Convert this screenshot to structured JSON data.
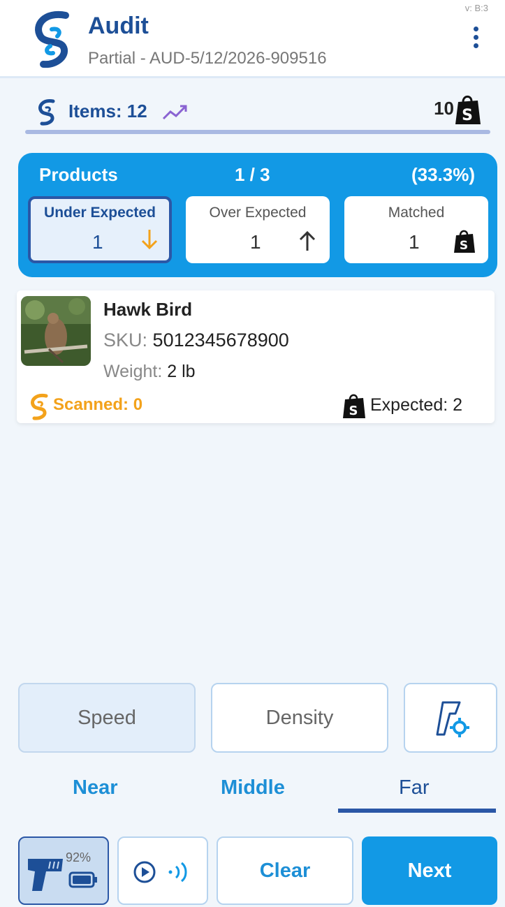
{
  "header": {
    "title": "Audit",
    "subtitle": "Partial - AUD-5/12/2026-909516",
    "version": "v: B:3"
  },
  "items_bar": {
    "label": "Items: 12",
    "shopify_count": "10"
  },
  "products": {
    "title": "Products",
    "ratio": "1 / 3",
    "percent": "(33.3%)",
    "stats": [
      {
        "label": "Under Expected",
        "value": "1",
        "icon": "arrow-down-icon"
      },
      {
        "label": "Over Expected",
        "value": "1",
        "icon": "arrow-up-icon"
      },
      {
        "label": "Matched",
        "value": "1",
        "icon": "shopify-bag-icon"
      }
    ]
  },
  "product_item": {
    "name": "Hawk Bird",
    "sku_label": "SKU:",
    "sku_value": "5012345678900",
    "weight_label": "Weight:",
    "weight_value": "2 lb",
    "scanned": "Scanned: 0",
    "expected": "Expected: 2"
  },
  "modes": {
    "speed": "Speed",
    "density": "Density"
  },
  "range_tabs": [
    "Near",
    "Middle",
    "Far"
  ],
  "bottom_bar": {
    "battery": "92%",
    "clear": "Clear",
    "next": "Next"
  },
  "colors": {
    "primary": "#1299e5",
    "brand_dark": "#1d4f97",
    "accent_orange": "#f3a21b"
  }
}
